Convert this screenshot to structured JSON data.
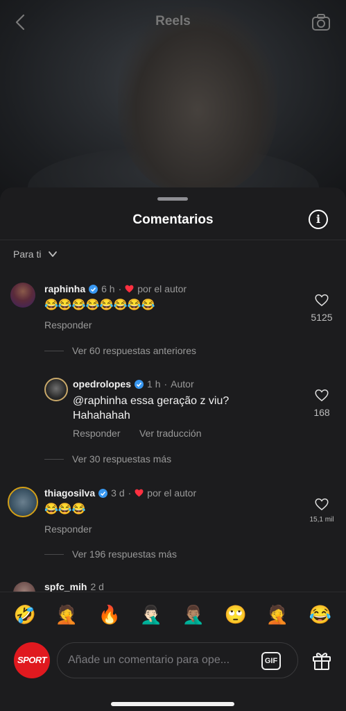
{
  "header": {
    "title": "Reels",
    "back_icon": "chevron-left-icon",
    "camera_icon": "camera-icon"
  },
  "sheet": {
    "title": "Comentarios",
    "info_icon": "info-icon",
    "sort_label": "Para ti"
  },
  "comments": [
    {
      "username": "raphinha",
      "time": "6 h",
      "by_author": "por el autor",
      "text": "😂😂😂😂😂😂😂😂",
      "reply_label": "Responder",
      "likes": "5125",
      "view_more": "Ver 60 respuestas anteriores"
    },
    {
      "username": "opedrolopes",
      "time": "1 h",
      "author_tag": "Autor",
      "text_line1": "@raphinha essa geração z viu?",
      "text_line2": "Hahahahah",
      "reply_label": "Responder",
      "translate_label": "Ver traducción",
      "likes": "168",
      "view_more": "Ver 30 respuestas más"
    },
    {
      "username": "thiagosilva",
      "time": "3 d",
      "by_author": "por el autor",
      "text": "😂😂😂",
      "reply_label": "Responder",
      "likes": "15,1 mil",
      "view_more": "Ver 196 respuestas más"
    },
    {
      "username": "spfc_mih",
      "time": "2 d"
    }
  ],
  "emoji_bar": [
    "🤣",
    "🤦",
    "🔥",
    "🤦🏻‍♂️",
    "🤦🏽‍♂️",
    "🙄",
    "🤦",
    "😂"
  ],
  "composer": {
    "brand_label": "SPORT",
    "placeholder": "Añade un comentario para ope...",
    "gif_label": "GIF",
    "gift_icon": "gift-icon"
  },
  "colors": {
    "verified": "#3897f0",
    "heart": "#ff3040",
    "brand": "#e0191f"
  }
}
